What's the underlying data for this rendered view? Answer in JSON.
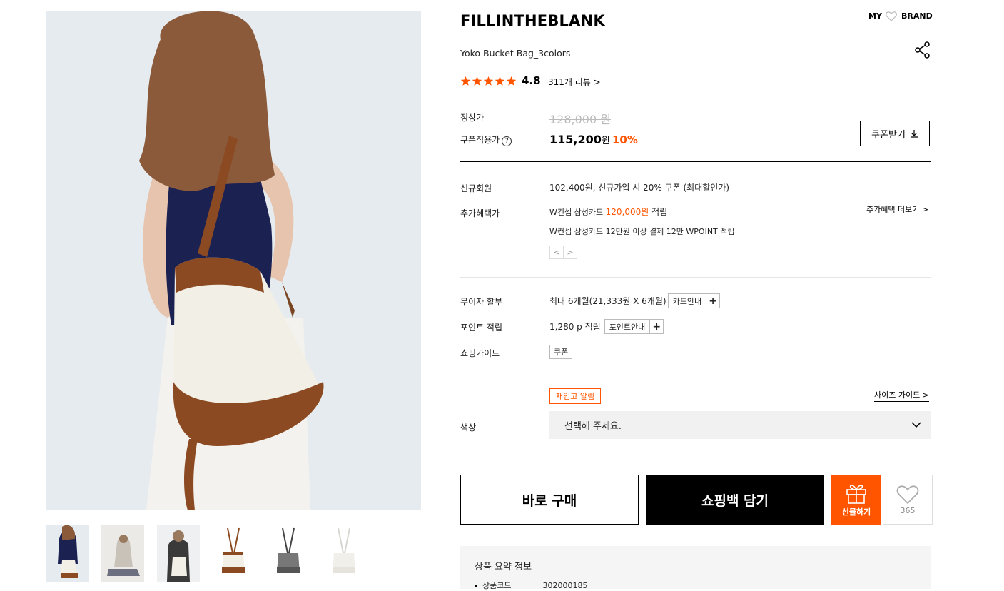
{
  "images": {
    "main_alt": "Model wearing Yoko Bucket Bag",
    "thumbnails": [
      "thumb-1",
      "thumb-2",
      "thumb-3",
      "thumb-4",
      "thumb-5",
      "thumb-6"
    ]
  },
  "header": {
    "brand": "FILLINTHEBLANK",
    "my_label": "MY",
    "brand_link_label": "BRAND",
    "product_name": "Yoko Bucket Bag_3colors"
  },
  "rating": {
    "score": "4.8",
    "review_count": "311",
    "review_suffix": "개 리뷰",
    "review_chevron": ">"
  },
  "price": {
    "regular_label": "정상가",
    "regular_price": "128,000 원",
    "coupon_label": "쿠폰적용가",
    "coupon_help": "?",
    "coupon_price": "115,200",
    "won": "원",
    "discount": "10%",
    "coupon_button": "쿠폰받기"
  },
  "benefits": {
    "new_member_label": "신규회원",
    "new_member_text": "102,400원, 신규가입 시 20% 쿠폰 (최대할인가)",
    "extra_label": "추가혜택가",
    "extra_line1_prefix": "W컨셉 삼성카드 ",
    "extra_line1_amount": "120,000원",
    "extra_line1_suffix": " 적립",
    "extra_line2": "W컨셉 삼성카드 12만원 이상 결제 12만 WPOINT 적립",
    "extra_more": "추가혜택 더보기 >",
    "prev": "<",
    "next": ">"
  },
  "details": {
    "installment_label": "무이자 할부",
    "installment_text": "최대 6개월(21,333원 X 6개월)",
    "card_guide": "카드안내",
    "point_label": "포인트 적립",
    "point_text": "1,280 p 적립",
    "point_guide": "포인트안내",
    "plus": "+",
    "shopping_guide_label": "쇼핑가이드",
    "shopping_guide_tag": "쿠폰"
  },
  "options": {
    "restock": "재입고 알림",
    "size_guide": "사이즈 가이드 >",
    "color_label": "색상",
    "color_placeholder": "선택해 주세요."
  },
  "actions": {
    "buy_now": "바로 구매",
    "add_cart": "쇼핑백 담기",
    "gift": "선물하기",
    "like_count": "365"
  },
  "summary": {
    "title": "상품 요약 정보",
    "code_label": "상품코드",
    "code_value": "302000185"
  },
  "colors": {
    "accent": "#ff5500",
    "black": "#000000",
    "gray_bg": "#f1f1f1"
  }
}
